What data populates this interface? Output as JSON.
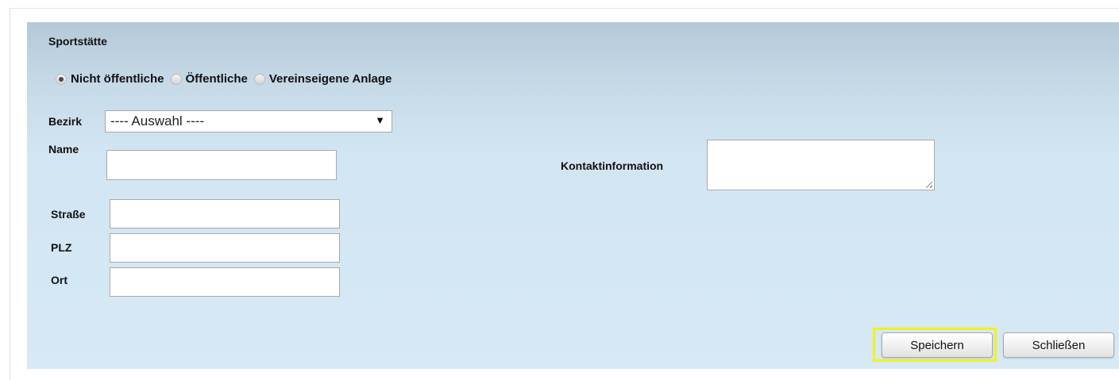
{
  "section_title": "Sportstätte",
  "radio_options": [
    {
      "label": "Nicht öffentliche",
      "checked": true
    },
    {
      "label": "Öffentliche",
      "checked": false
    },
    {
      "label": "Vereinseigene Anlage",
      "checked": false
    }
  ],
  "fields": {
    "bezirk_label": "Bezirk",
    "bezirk_selected": "---- Auswahl ----",
    "name_label": "Name",
    "name_value": "",
    "kontakt_label": "Kontaktinformation",
    "kontakt_value": "",
    "strasse_label": "Straße",
    "strasse_value": "",
    "plz_label": "PLZ",
    "plz_value": "",
    "ort_label": "Ort",
    "ort_value": ""
  },
  "buttons": {
    "save": "Speichern",
    "close": "Schließen"
  },
  "colors": {
    "highlight": "#f2f21a",
    "panel": "#d6e9f5"
  }
}
